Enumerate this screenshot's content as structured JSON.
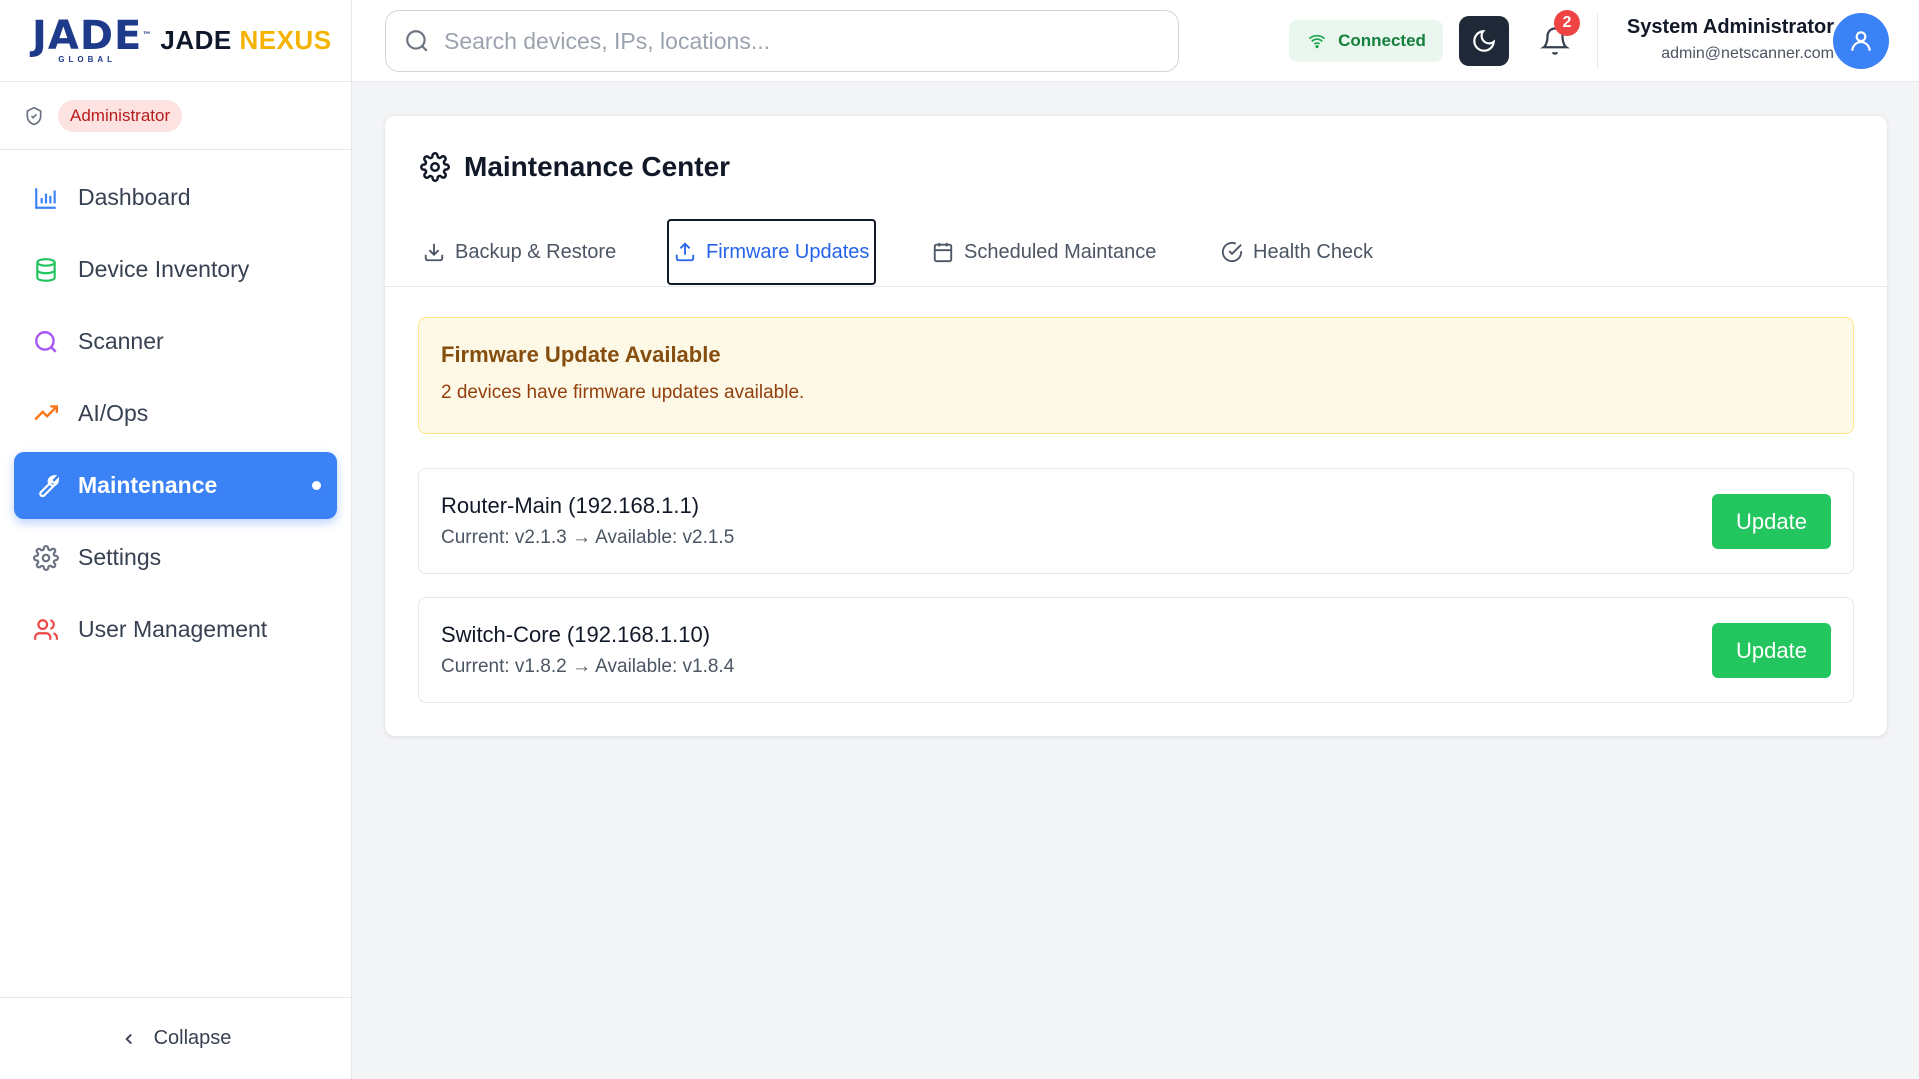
{
  "brand": {
    "logo_text": "JADE",
    "logo_tm": "™",
    "logo_sub": "GLOBAL",
    "name_part1": "JADE",
    "name_part2": "NEXUS"
  },
  "role": {
    "label": "Administrator"
  },
  "sidebar": {
    "items": [
      {
        "label": "Dashboard",
        "icon": "bar-chart-icon",
        "color": "#3b82f6"
      },
      {
        "label": "Device Inventory",
        "icon": "database-icon",
        "color": "#22c55e"
      },
      {
        "label": "Scanner",
        "icon": "search-icon",
        "color": "#a855f7"
      },
      {
        "label": "AI/Ops",
        "icon": "trending-up-icon",
        "color": "#f97316"
      },
      {
        "label": "Maintenance",
        "icon": "wrench-icon",
        "active": true
      },
      {
        "label": "Settings",
        "icon": "gear-icon",
        "color": "#6b7280"
      },
      {
        "label": "User Management",
        "icon": "users-icon",
        "color": "#ef4444"
      }
    ],
    "collapse_label": "Collapse"
  },
  "header": {
    "search_placeholder": "Search devices, IPs, locations...",
    "connection_status": "Connected",
    "notification_count": "2",
    "user_name": "System Administrator",
    "user_email": "admin@netscanner.com"
  },
  "main": {
    "title": "Maintenance Center",
    "tabs": [
      {
        "label": "Backup & Restore",
        "icon": "download-icon"
      },
      {
        "label": "Firmware Updates",
        "icon": "upload-icon",
        "active": true
      },
      {
        "label": "Scheduled Maintance",
        "icon": "calendar-icon"
      },
      {
        "label": "Health Check",
        "icon": "check-circle-icon"
      }
    ],
    "alert": {
      "title": "Firmware Update Available",
      "text": "2 devices have firmware updates available."
    },
    "devices": [
      {
        "name": "Router-Main (192.168.1.1)",
        "version": "Current: v2.1.3 → Available: v2.1.5",
        "button": "Update"
      },
      {
        "name": "Switch-Core (192.168.1.10)",
        "version": "Current: v1.8.2 → Available: v1.8.4",
        "button": "Update"
      }
    ]
  },
  "colors": {
    "accent": "#3b82f6",
    "success": "#22c55e",
    "brand_yellow": "#f5b301",
    "alert_bg": "#fef9e7"
  }
}
